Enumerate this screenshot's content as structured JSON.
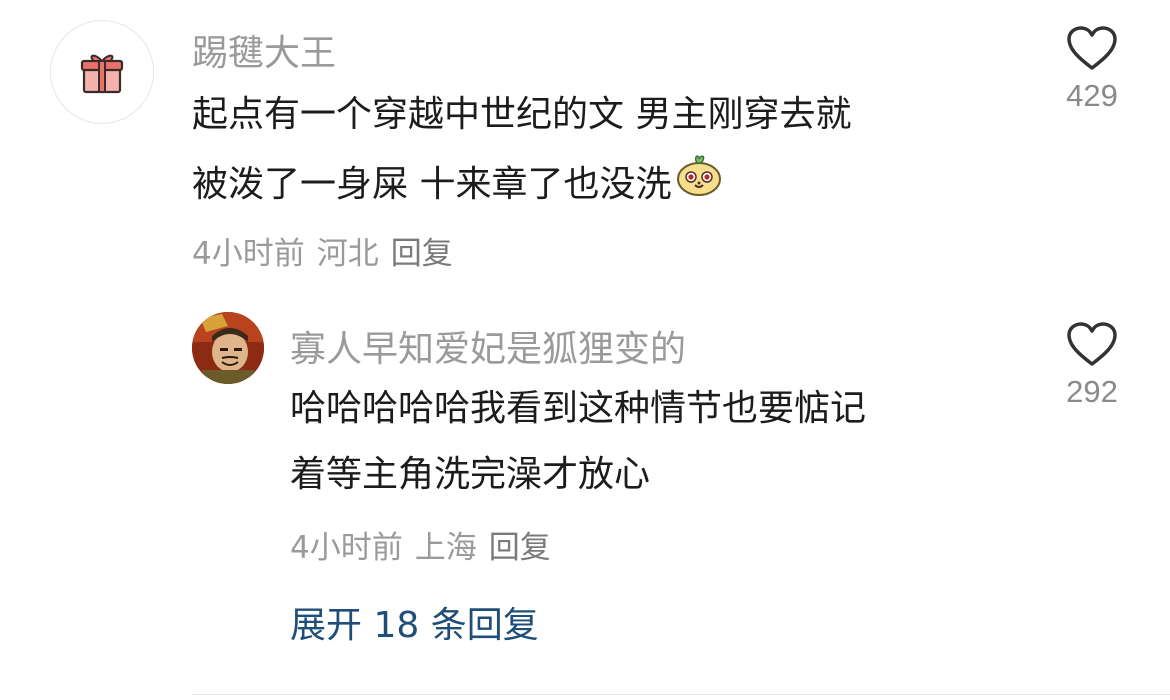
{
  "comments": [
    {
      "username": "踢毽大王",
      "avatar_icon": "gift-icon",
      "lines": [
        "起点有一个穿越中世纪的文 男主刚穿去就",
        "被泼了一身屎 十来章了也没洗"
      ],
      "emoji_icon": "cute-face-emoji-icon",
      "time": "4小时前",
      "location": "河北",
      "reply_label": "回复",
      "likes": "429"
    },
    {
      "username": "寡人早知爱妃是狐狸变的",
      "avatar_icon": "cartoon-character-avatar",
      "lines": [
        "哈哈哈哈哈我看到这种情节也要惦记",
        "着等主角洗完澡才放心"
      ],
      "time": "4小时前",
      "location": "上海",
      "reply_label": "回复",
      "likes": "292"
    }
  ],
  "expand_replies": "展开 18 条回复",
  "colors": {
    "username": "#9a9a9a",
    "body": "#1c1c1c",
    "link": "#1f4e79",
    "gift": "#e8736a"
  }
}
